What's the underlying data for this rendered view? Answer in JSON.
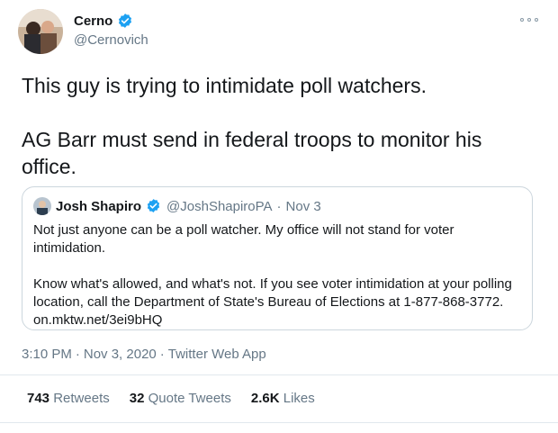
{
  "author": {
    "name": "Cerno",
    "handle": "@Cernovich",
    "verified_color": "#1da1f2"
  },
  "tweet": {
    "paragraphs": [
      "This guy is trying to intimidate poll watchers.",
      "AG Barr must send in federal troops to monitor his office."
    ]
  },
  "quote": {
    "name": "Josh Shapiro",
    "handle": "@JoshShapiroPA",
    "separator": "·",
    "date": "Nov 3",
    "paragraphs": [
      "Not just anyone can be a poll watcher. My office will not stand for voter intimidation.",
      "Know what's allowed, and what's not. If you see voter intimidation at your polling location, call the Department of State's Bureau of Elections at 1-877-868-3772. on.mktw.net/3ei9bHQ"
    ]
  },
  "meta": {
    "time": "3:10 PM",
    "sep1": "·",
    "date": "Nov 3, 2020",
    "sep2": "·",
    "source": "Twitter Web App"
  },
  "stats": {
    "retweets_count": "743",
    "retweets_label": "Retweets",
    "quotes_count": "32",
    "quotes_label": "Quote Tweets",
    "likes_count": "2.6K",
    "likes_label": "Likes"
  }
}
